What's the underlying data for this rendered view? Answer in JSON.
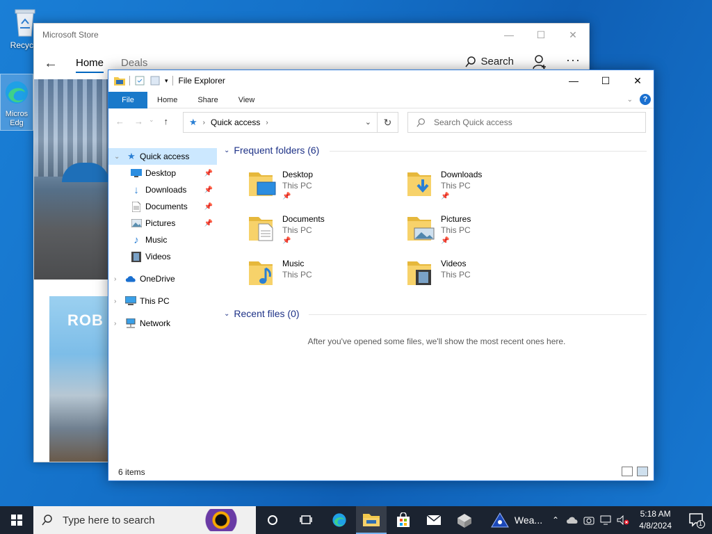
{
  "desktop": {
    "icons": [
      {
        "label": "Recycle",
        "icon": "recycle-bin-icon"
      },
      {
        "label": "Micros Edg",
        "icon": "edge-icon"
      }
    ]
  },
  "store": {
    "title": "Microsoft Store",
    "tabs": [
      "Home",
      "Deals"
    ],
    "active_tab": "Home",
    "search_label": "Search",
    "card_logo_text": "ROB"
  },
  "explorer": {
    "title": "File Explorer",
    "ribbon_tabs": [
      "File",
      "Home",
      "Share",
      "View"
    ],
    "address": {
      "crumb": "Quick access"
    },
    "search_placeholder": "Search Quick access",
    "nav": {
      "quick_access": "Quick access",
      "pinned": [
        "Desktop",
        "Downloads",
        "Documents",
        "Pictures"
      ],
      "unpinned": [
        "Music",
        "Videos"
      ],
      "roots": [
        "OneDrive",
        "This PC",
        "Network"
      ]
    },
    "frequent": {
      "header": "Frequent folders (6)",
      "items": [
        {
          "name": "Desktop",
          "location": "This PC",
          "pinned": true
        },
        {
          "name": "Downloads",
          "location": "This PC",
          "pinned": true
        },
        {
          "name": "Documents",
          "location": "This PC",
          "pinned": true
        },
        {
          "name": "Pictures",
          "location": "This PC",
          "pinned": true
        },
        {
          "name": "Music",
          "location": "This PC",
          "pinned": false
        },
        {
          "name": "Videos",
          "location": "This PC",
          "pinned": false
        }
      ]
    },
    "recent": {
      "header": "Recent files (0)",
      "empty_message": "After you've opened some files, we'll show the most recent ones here."
    },
    "status": "6 items"
  },
  "taskbar": {
    "search_placeholder": "Type here to search",
    "weather_label": "Wea...",
    "time": "5:18 AM",
    "date": "4/8/2024",
    "notification_count": "1"
  },
  "colors": {
    "accent": "#1979ca",
    "selection": "#cce8ff",
    "section_header": "#1e3287",
    "folder": "#f3c94c",
    "taskbar": "#1b2330"
  }
}
